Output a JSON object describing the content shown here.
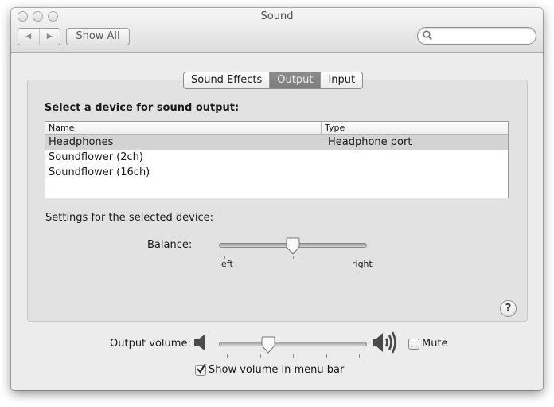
{
  "window": {
    "title": "Sound",
    "traffic_lights": [
      "close",
      "minimize",
      "zoom"
    ]
  },
  "toolbar": {
    "back_icon": "triangle-left",
    "forward_icon": "triangle-right",
    "show_all_label": "Show All",
    "search_placeholder": "",
    "search_value": ""
  },
  "tabs": [
    {
      "label": "Sound Effects",
      "active": false
    },
    {
      "label": "Output",
      "active": true
    },
    {
      "label": "Input",
      "active": false
    }
  ],
  "output": {
    "section_title": "Select a device for sound output:",
    "columns": [
      "Name",
      "Type"
    ],
    "devices": [
      {
        "name": "Headphones",
        "type": "Headphone port",
        "selected": true
      },
      {
        "name": "Soundflower (2ch)",
        "type": "",
        "selected": false
      },
      {
        "name": "Soundflower (16ch)",
        "type": "",
        "selected": false
      }
    ],
    "settings_label": "Settings for the selected device:",
    "balance": {
      "label": "Balance:",
      "value": 0.5,
      "min_label": "left",
      "max_label": "right"
    }
  },
  "help_label": "?",
  "volume": {
    "label": "Output volume:",
    "value": 0.32,
    "tick_count": 5,
    "mute_label": "Mute",
    "mute_checked": false,
    "show_in_menu_bar_label": "Show volume in menu bar",
    "show_in_menu_bar_checked": true
  },
  "colors": {
    "window_bg": "#ececec",
    "panel_bg": "#e2e2e2",
    "selected_row": "#d3d3d3",
    "active_tab": "#838383"
  }
}
